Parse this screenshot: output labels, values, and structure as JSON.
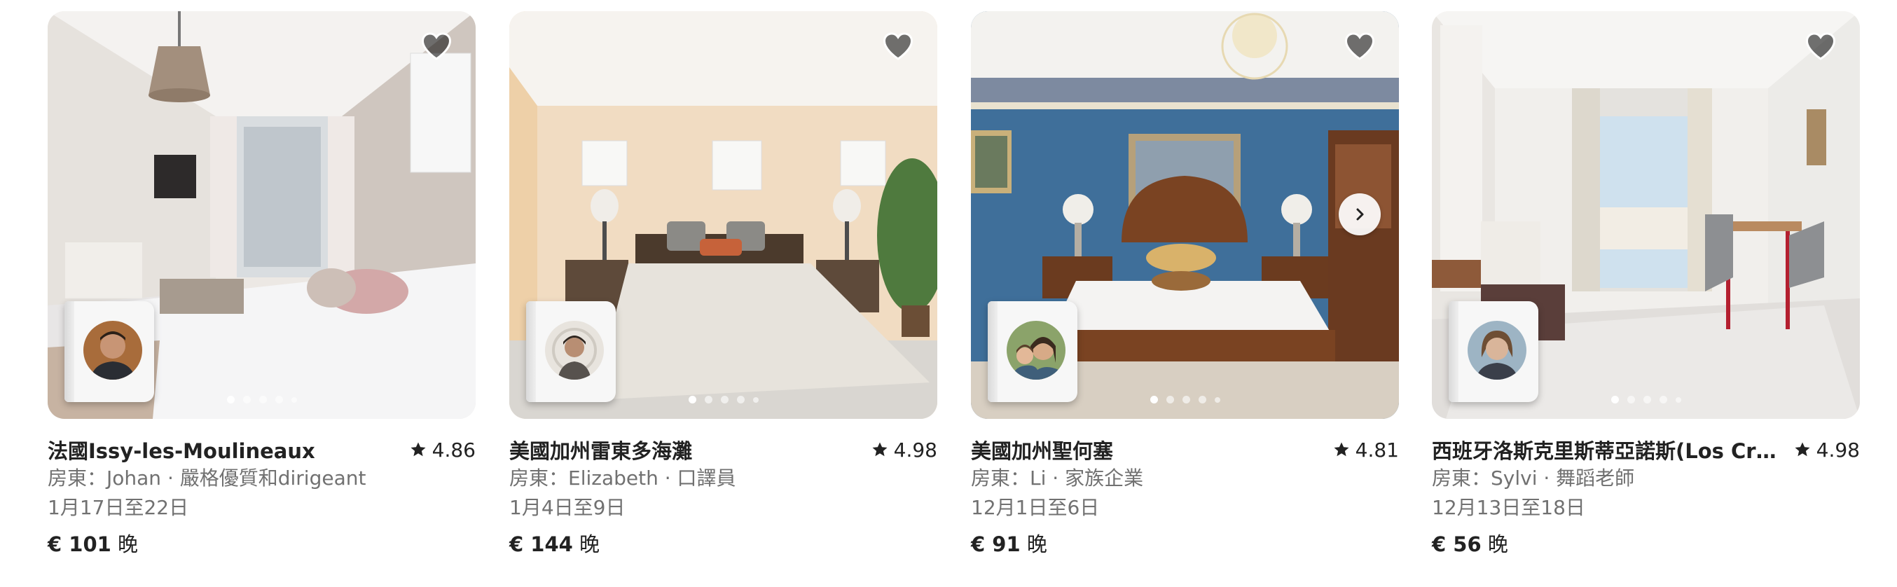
{
  "listings": [
    {
      "location": "法國Issy-les-Moulineaux",
      "rating": "4.86",
      "host_line": "房東：Johan · 嚴格優質和dirigeant",
      "dates": "1月17日至22日",
      "price": "€ 101",
      "price_unit": "晚",
      "favorite_icon": "heart-icon",
      "active_photo_dot": 1
    },
    {
      "location": "美國加州雷東多海灘",
      "rating": "4.98",
      "host_line": "房東：Elizabeth · 口譯員",
      "dates": "1月4日至9日",
      "price": "€ 144",
      "price_unit": "晚",
      "favorite_icon": "heart-icon",
      "active_photo_dot": 1
    },
    {
      "location": "美國加州聖何塞",
      "rating": "4.81",
      "host_line": "房東：Li · 家族企業",
      "dates": "12月1日至6日",
      "price": "€ 91",
      "price_unit": "晚",
      "favorite_icon": "heart-icon",
      "active_photo_dot": 1
    },
    {
      "location": "西班牙洛斯克里斯蒂亞諾斯(Los Cri...",
      "rating": "4.98",
      "host_line": "房東：Sylvi · 舞蹈老師",
      "dates": "12月13日至18日",
      "price": "€ 56",
      "price_unit": "晚",
      "favorite_icon": "heart-icon",
      "active_photo_dot": 1
    }
  ],
  "colors": {
    "text_primary": "#222222",
    "text_secondary": "#717171",
    "heart_fill": "#4a4a4a",
    "background": "#ffffff"
  },
  "icons": {
    "rating": "star-icon",
    "favorite": "heart-icon",
    "next": "chevron-right-icon"
  }
}
